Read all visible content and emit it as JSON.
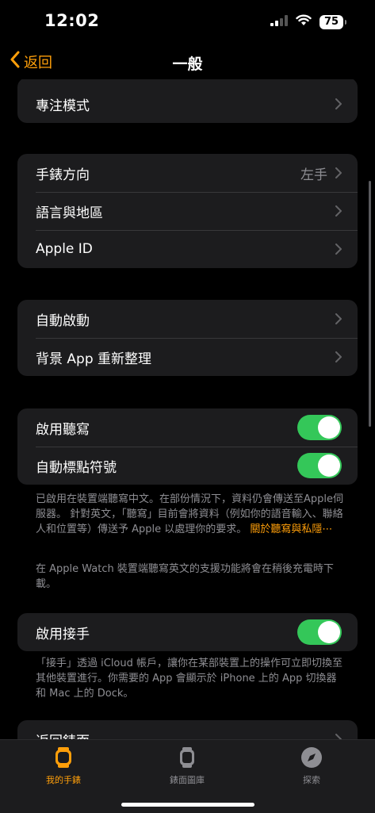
{
  "status": {
    "time": "12:02",
    "battery": "75"
  },
  "nav": {
    "back_label": "返回",
    "title": "一般"
  },
  "groups": {
    "g0": {
      "focus": "專注模式"
    },
    "g1": {
      "orientation": "手錶方向",
      "orientation_value": "左手",
      "language": "語言與地區",
      "apple_id": "Apple ID"
    },
    "g2": {
      "auto_launch": "自動啟動",
      "bg_refresh": "背景 App 重新整理"
    },
    "g3": {
      "dictation": "啟用聽寫",
      "auto_punct": "自動標點符號"
    },
    "g4": {
      "handoff": "啟用接手"
    },
    "g5": {
      "return_face": "返回錶面"
    }
  },
  "notes": {
    "dictation_1": "已啟用在裝置端聽寫中文。在部份情況下，資料仍會傳送至Apple伺服器。 針對英文，「聽寫」目前會將資料（例如你的語音輸入、聯絡人和位置等）傳送予 Apple 以處理你的要求。",
    "dictation_link": "關於聽寫與私隱⋯",
    "dictation_2": "在 Apple Watch 裝置端聽寫英文的支援功能將會在稍後充電時下載。",
    "handoff": "「接手」透過 iCloud 帳戶，讓你在某部裝置上的操作可立即切換至其他裝置進行。你需要的 App 會顯示於 iPhone 上的 App 切換器和 Mac 上的 Dock。"
  },
  "tabs": {
    "my_watch": "我的手錶",
    "face_gallery": "錶面圖庫",
    "discover": "探索"
  },
  "colors": {
    "accent": "#ff9f0a",
    "toggle_on": "#34c759",
    "cell": "#1c1c1e",
    "secondary": "#8e8e93"
  }
}
